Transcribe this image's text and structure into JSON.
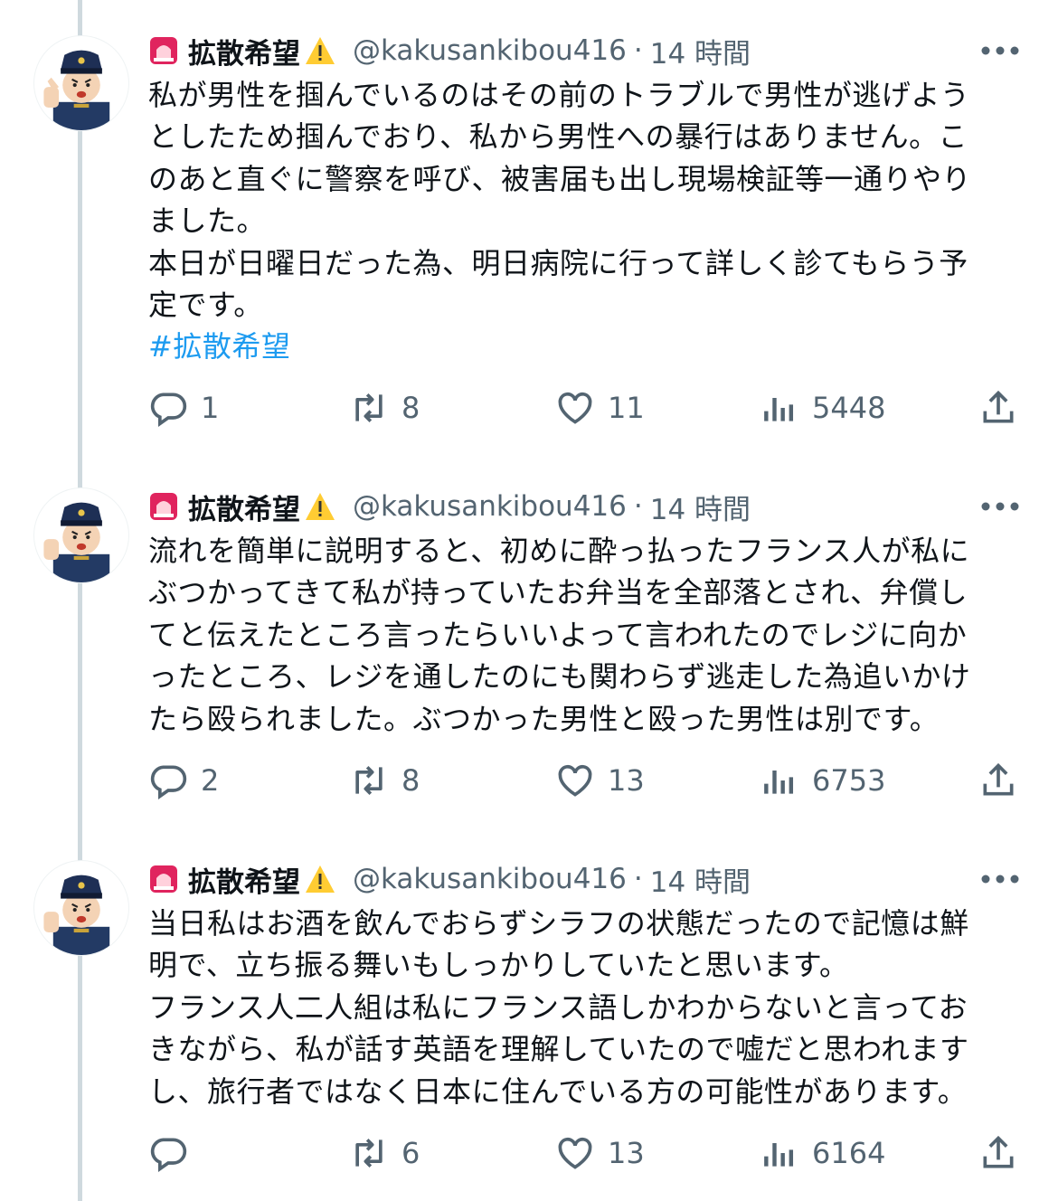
{
  "tweets": [
    {
      "display_name": "拡散希望",
      "handle": "@kakusankibou416",
      "separator": "·",
      "time": "14 時間",
      "text": "私が男性を掴んでいるのはその前のトラブルで男性が逃げよう\nとしたため掴んでおり、私から男性への暴行はありません。こ\nのあと直ぐに警察を呼び、被害届も出し現場検証等一通りやり\nました。\n本日が日曜日だった為、明日病院に行って詳しく診てもらう予\n定です。",
      "hashtag": "#拡散希望",
      "replies": "1",
      "reposts": "8",
      "likes": "11",
      "views": "5448"
    },
    {
      "display_name": "拡散希望",
      "handle": "@kakusankibou416",
      "separator": "·",
      "time": "14 時間",
      "text": "流れを簡単に説明すると、初めに酔っ払ったフランス人が私に\nぶつかってきて私が持っていたお弁当を全部落とされ、弁償し\nてと伝えたところ言ったらいいよって言われたのでレジに向か\nったところ、レジを通したのにも関わらず逃走した為追いかけ\nたら殴られました。ぶつかった男性と殴った男性は別です。",
      "replies": "2",
      "reposts": "8",
      "likes": "13",
      "views": "6753"
    },
    {
      "display_name": "拡散希望",
      "handle": "@kakusankibou416",
      "separator": "·",
      "time": "14 時間",
      "text": "当日私はお酒を飲んでおらずシラフの状態だったので記憶は鮮\n明で、立ち振る舞いもしっかりしていたと思います。\nフランス人二人組は私にフランス語しかわからないと言ってお\nきながら、私が話す英語を理解していたので嘘だと思われます\nし、旅行者ではなく日本に住んでいる方の可能性があります。",
      "replies": "",
      "reposts": "6",
      "likes": "13",
      "views": "6164"
    }
  ],
  "colors": {
    "text": "#0f1419",
    "secondary": "#536471",
    "link": "#1d9bf0",
    "thread_line": "#cfd9de"
  },
  "icons": [
    "police-avatar",
    "siren-icon",
    "warning-icon",
    "more-icon",
    "reply-icon",
    "repost-icon",
    "like-icon",
    "views-icon",
    "share-icon"
  ]
}
